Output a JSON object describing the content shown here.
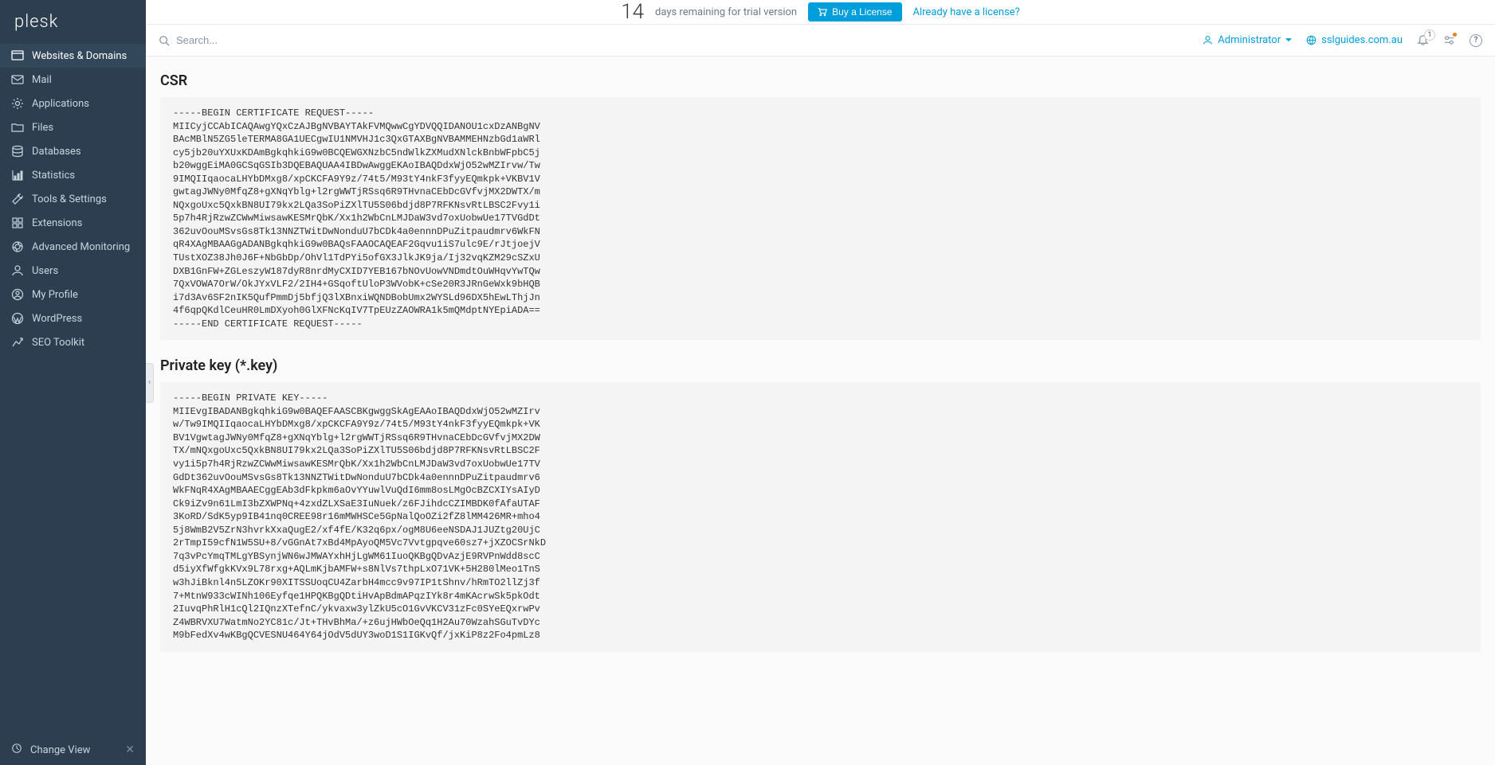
{
  "logo": "plesk",
  "trial": {
    "days": "14",
    "text": "days remaining for trial version",
    "buy_label": "Buy a License",
    "license_link": "Already have a license?"
  },
  "search": {
    "placeholder": "Search..."
  },
  "topbar": {
    "admin": "Administrator",
    "domain": "sslguides.com.au",
    "notif_count": "1"
  },
  "nav": {
    "websites": "Websites & Domains",
    "mail": "Mail",
    "applications": "Applications",
    "files": "Files",
    "databases": "Databases",
    "statistics": "Statistics",
    "tools": "Tools & Settings",
    "extensions": "Extensions",
    "monitoring": "Advanced Monitoring",
    "users": "Users",
    "profile": "My Profile",
    "wordpress": "WordPress",
    "seo": "SEO Toolkit"
  },
  "footer": {
    "change_view": "Change View"
  },
  "content": {
    "csr_heading": "CSR",
    "csr_body": "-----BEGIN CERTIFICATE REQUEST-----\nMIICyjCCAbICAQAwgYQxCzAJBgNVBAYTAkFVMQwwCgYDVQQIDANOU1cxDzANBgNV\nBAcMBlN5ZG5leTERMA8GA1UECgwIU1NMVHJ1c3QxGTAXBgNVBAMMEHNzbGd1aWRl\ncy5jb20uYXUxKDAmBgkqhkiG9w0BCQEWGXNzbC5ndWlkZXMudXNlckBnbWFpbC5j\nb20wggEiMA0GCSqGSIb3DQEBAQUAA4IBDwAwggEKAoIBAQDdxWjO52wMZIrvw/Tw\n9IMQIIqaocaLHYbDMxg8/xpCKCFA9Y9z/74t5/M93tY4nkF3fyyEQmkpk+VKBV1V\ngwtagJWNy0MfqZ8+gXNqYblg+l2rgWWTjRSsq6R9THvnaCEbDcGVfvjMX2DWTX/m\nNQxgoUxc5QxkBN8UI79kx2LQa3SoPiZXlTU5S06bdjd8P7RFKNsvRtLBSC2Fvy1i\n5p7h4RjRzwZCWwMiwsawKESMrQbK/Xx1h2WbCnLMJDaW3vd7oxUobwUe17TVGdDt\n362uvOouMSvsGs8Tk13NNZTWitDwNonduU7bCDk4a0ennnDPuZitpaudmrv6WkFN\nqR4XAgMBAAGgADANBgkqhkiG9w0BAQsFAAOCAQEAF2Gqvu1iS7ulc9E/rJtjoejV\nTUstXOZ38Jh0J6F+NbGbDp/OhVl1TdPYi5ofGX3JlkJK9ja/Ij32vqKZM29cSZxU\nDXB1GnFW+ZGLeszyW187dyR8nrdMyCXID7YEB167bNOvUowVNDmdtOuWHqvYwTQw\n7QxVOWA7OrW/OkJYxVLF2/2IH4+GSqoftUloP3WVobK+cSe20R3JRnGeWxk9bHQB\ni7d3Av6SF2nIK5QufPmmDj5bfjQ3lXBnxiWQNDBobUmx2WYSLd96DX5hEwLThjJn\n4f6qpQKdlCeuHR0LmDXyoh0GlXFNcKqIV7TpEUzZAOWRA1k5mQMdptNYEpiADA==\n-----END CERTIFICATE REQUEST-----",
    "key_heading": "Private key (*.key)",
    "key_body": "-----BEGIN PRIVATE KEY-----\nMIIEvgIBADANBgkqhkiG9w0BAQEFAASCBKgwggSkAgEAAoIBAQDdxWjO52wMZIrv\nw/Tw9IMQIIqaocaLHYbDMxg8/xpCKCFA9Y9z/74t5/M93tY4nkF3fyyEQmkpk+VK\nBV1VgwtagJWNy0MfqZ8+gXNqYblg+l2rgWWTjRSsq6R9THvnaCEbDcGVfvjMX2DW\nTX/mNQxgoUxc5QxkBN8UI79kx2LQa3SoPiZXlTU5S06bdjd8P7RFKNsvRtLBSC2F\nvy1i5p7h4RjRzwZCWwMiwsawKESMrQbK/Xx1h2WbCnLMJDaW3vd7oxUobwUe17TV\nGdDt362uvOouMSvsGs8Tk13NNZTWitDwNonduU7bCDk4a0ennnDPuZitpaudmrv6\nWkFNqR4XAgMBAAECggEAb3dFkpkm6aOvYYuwlVuQdI6mm8osLMgOcBZCXIYsAIyD\nCk9iZv9n61LmI3bZXWPNq+4zxdZLXSaE3IuNuek/z6FJihdcCZIMBDK0fAfaUTAF\n3KoRD/SdK5yp9IB41nq0CREE98r16mMWHSCe5GpNalQoOZi2fZ8lMM426MR+mho4\n5j8WmB2V5ZrN3hvrkXxaQugE2/xf4fE/K32q6px/ogM8U6eeNSDAJ1JUZtg20UjC\n2rTmpI59cfN1W5SU+8/vGGnAt7xBd4MpAyoQM5Vc7Vvtgpqve60sz7+jXZOCSrNkD\n7q3vPcYmqTMLgYBSynjWN6wJMWAYxhHjLgWM61IuoQKBgQDvAzjE9RVPnWdd8scC\nd5iyXfWfgkKVx9L78rxg+AQLmKjbAMFW+s8NlVs7thpLxO71VK+5H280lMeo1TnS\nw3hJiBknl4n5LZOKr90XITSSUoqCU4ZarbH4mcc9v97IP1tShnv/hRmTO2llZj3f\n7+MtnW933cWINh106Eyfqe1HPQKBgQDtiHvApBdmAPqzIYk8r4mKAcrwSk5pkOdt\n2IuvqPhRlH1cQl2IQnzXTefnC/ykvaxw3ylZkU5cO1GvVKCV31zFc0SYeEQxrwPv\nZ4WBRVXU7WatmNo2YC81c/Jt+THvBhMa/+z6ujHWbOeQq1H2Au70WzahSGuTvDYc\nM9bFedXv4wKBgQCVESNU464Y64jOdV5dUY3woD1S1IGKvQf/jxKiP8z2Fo4pmLz8"
  }
}
